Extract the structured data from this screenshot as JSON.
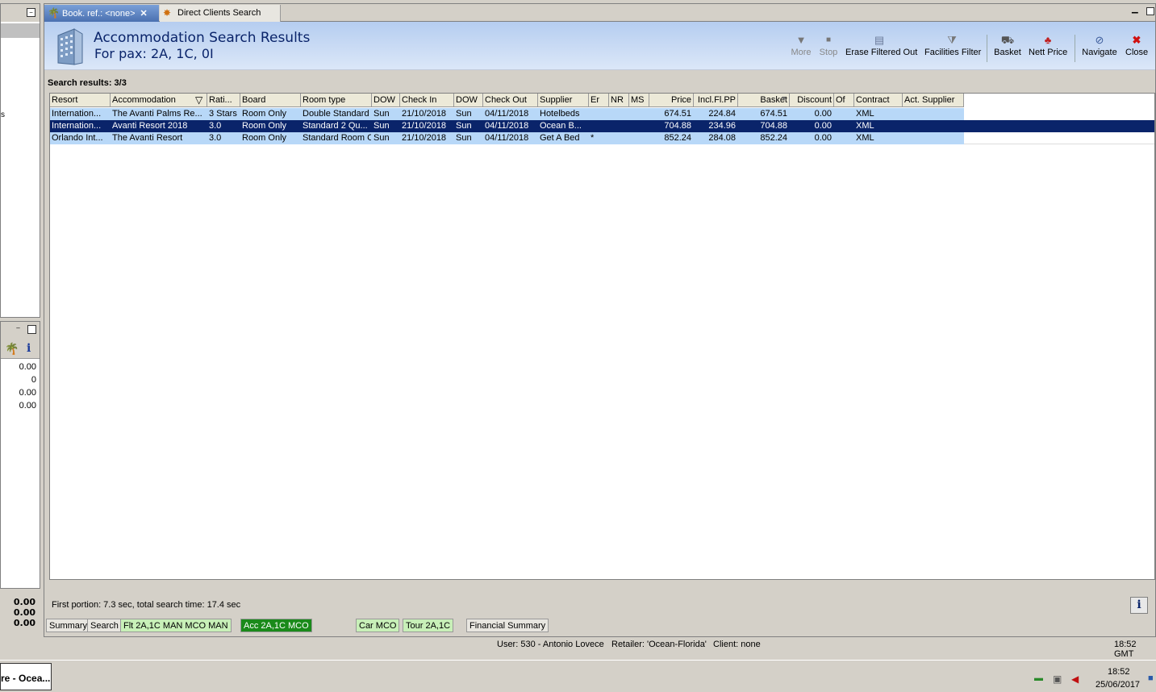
{
  "tabs": [
    {
      "label": "Book. ref.: <none>",
      "icon": "palm-tree-icon",
      "active": true
    },
    {
      "label": "Direct Clients Search",
      "icon": "people-icon",
      "active": false
    }
  ],
  "header": {
    "title": "Accommodation Search Results",
    "subtitle": "For pax: 2A, 1C, 0I"
  },
  "toolbar": [
    {
      "label": "More",
      "icon": "arrow-down-icon",
      "enabled": false
    },
    {
      "label": "Stop",
      "icon": "stop-icon",
      "enabled": false
    },
    {
      "label": "Erase Filtered Out",
      "icon": "erase-filter-icon",
      "enabled": true
    },
    {
      "label": "Facilities Filter",
      "icon": "filter-icon",
      "enabled": true
    },
    {
      "label": "Basket",
      "icon": "basket-icon",
      "enabled": true
    },
    {
      "label": "Nett Price",
      "icon": "nett-price-icon",
      "enabled": true
    },
    {
      "label": "Navigate",
      "icon": "navigate-icon",
      "enabled": true
    },
    {
      "label": "Close",
      "icon": "close-icon",
      "enabled": true
    }
  ],
  "results_label": "Search results: 3/3",
  "columns": [
    "Resort",
    "Accommodation",
    "Rati...",
    "Board",
    "Room type",
    "DOW",
    "Check In",
    "DOW",
    "Check Out",
    "Supplier",
    "Er",
    "NR",
    "MS",
    "Price",
    "Incl.Fl.PP",
    "Basket",
    "Discount",
    "Of",
    "Contract",
    "Act. Supplier"
  ],
  "rows": [
    [
      "Internation...",
      "The Avanti Palms Re...",
      "3 Stars",
      "Room Only",
      "Double Standard",
      "Sun",
      "21/10/2018",
      "Sun",
      "04/11/2018",
      "Hotelbeds",
      "",
      "",
      "",
      "674.51",
      "224.84",
      "674.51",
      "0.00",
      "",
      "XML",
      ""
    ],
    [
      "Internation...",
      "Avanti Resort 2018",
      "3.0",
      "Room Only",
      "Standard 2 Qu...",
      "Sun",
      "21/10/2018",
      "Sun",
      "04/11/2018",
      "Ocean B...",
      "",
      "",
      "",
      "704.88",
      "234.96",
      "704.88",
      "0.00",
      "",
      "XML",
      ""
    ],
    [
      "Orlando Int...",
      "The Avanti Resort",
      "3.0",
      "Room Only",
      "Standard Room C",
      "Sun",
      "21/10/2018",
      "Sun",
      "04/11/2018",
      "Get A Bed",
      "*",
      "",
      "",
      "852.24",
      "284.08",
      "852.24",
      "0.00",
      "",
      "XML",
      ""
    ]
  ],
  "selected_row": 1,
  "status_text": "First portion: 7.3 sec, total search time: 17.4 sec",
  "bottom_tabs": [
    {
      "label": "Summary",
      "style": "plain"
    },
    {
      "label": "Search",
      "style": "plain"
    },
    {
      "label": "Flt 2A,1C MAN MCO MAN",
      "style": "green"
    },
    {
      "label": "Acc 2A,1C MCO",
      "style": "active"
    },
    {
      "label": "Car MCO",
      "style": "green"
    },
    {
      "label": "Tour 2A,1C",
      "style": "green"
    },
    {
      "label": "Financial Summary",
      "style": "plain"
    }
  ],
  "left_panel": {
    "side_text": "s",
    "values": [
      "0.00",
      "0",
      "0.00",
      "0.00"
    ],
    "totals": [
      "0.00",
      "0.00",
      "0.00"
    ]
  },
  "statusbar": {
    "user": "User: 530 - Antonio Lovece",
    "retailer": "Retailer: 'Ocean-Florida'",
    "client": "Client: none",
    "time": "18:52 GMT"
  },
  "taskbar": {
    "button": "re - Ocea...",
    "clock_time": "18:52",
    "clock_date": "25/06/2017"
  },
  "colors": {
    "selected_row": "#0a246a",
    "row_highlight": "#b8d8f8",
    "title": "#0a246a",
    "active_tab_green": "#1a8a1a"
  }
}
